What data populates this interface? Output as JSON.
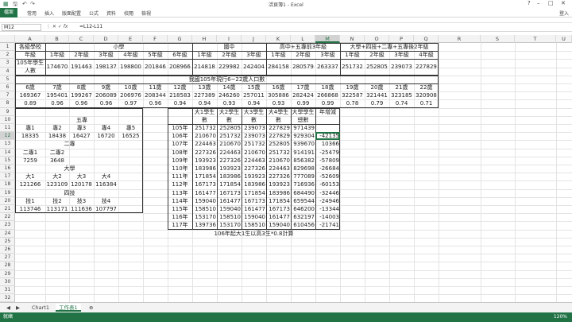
{
  "window": {
    "title": "活頁簿1 - Excel",
    "user": "登入"
  },
  "ribbon": {
    "file": "檔案",
    "tabs": [
      "常用",
      "插入",
      "版面配置",
      "公式",
      "資料",
      "校閱",
      "檢視"
    ]
  },
  "formula_bar": {
    "name_box": "M12",
    "formula": "=L12-L11"
  },
  "columns": [
    "A",
    "B",
    "C",
    "D",
    "E",
    "F",
    "G",
    "H",
    "I",
    "J",
    "K",
    "L",
    "M",
    "N",
    "O",
    "P",
    "Q",
    "R",
    "S",
    "T",
    "U"
  ],
  "rows": [
    "1",
    "2",
    "3",
    "4",
    "5",
    "6",
    "7",
    "8",
    "9",
    "10",
    "11",
    "12",
    "13",
    "14",
    "15",
    "16",
    "17",
    "18",
    "19",
    "20",
    "21",
    "22",
    "23",
    "24",
    "25",
    "26",
    "27",
    "28",
    "29",
    "30",
    "31",
    "32"
  ],
  "table1": {
    "header": [
      "各級學校",
      "小學",
      "國中",
      "高中+五專前3年級",
      "大學+四技+二專+五專後2年級"
    ],
    "grades": [
      "年級",
      "1年級",
      "2年級",
      "3年級",
      "4年級",
      "5年級",
      "6年級",
      "1年級",
      "2年級",
      "3年級",
      "1年級",
      "2年級",
      "3年級",
      "1年級",
      "2年級",
      "3年級",
      "4年級"
    ],
    "label": "105年學生人數",
    "values": [
      "174670",
      "191463",
      "198137",
      "198800",
      "201846",
      "208966",
      "214818",
      "229982",
      "242404",
      "284158",
      "280579",
      "263337",
      "251732",
      "252805",
      "239073",
      "227829"
    ]
  },
  "table2": {
    "title": "我國105年現行6~22歲人口數",
    "ages": [
      "6歲",
      "7歲",
      "8歲",
      "9歲",
      "10歲",
      "11歲",
      "12歲",
      "13歲",
      "14歲",
      "15歲",
      "16歲",
      "17歲",
      "18歲",
      "19歲",
      "20歲",
      "21歲",
      "22歲"
    ],
    "pop": [
      "169367",
      "195401",
      "199267",
      "206089",
      "206976",
      "208344",
      "218583",
      "227389",
      "246260",
      "257011",
      "305886",
      "282424",
      "266868",
      "322587",
      "321441",
      "323185",
      "320908"
    ],
    "rate_label": "就學率",
    "rates": [
      "0.89",
      "0.96",
      "0.96",
      "0.96",
      "0.97",
      "0.96",
      "0.94",
      "0.94",
      "0.93",
      "0.94",
      "0.93",
      "0.99",
      "0.99",
      "0.78",
      "0.79",
      "0.74",
      "0.71"
    ]
  },
  "table3": {
    "title": "五專",
    "h1": [
      "專1",
      "專2",
      "專3",
      "專4",
      "專5"
    ],
    "v1": [
      "18335",
      "18438",
      "16427",
      "16720",
      "16525"
    ],
    "t2": "二專",
    "h2": [
      "二專1",
      "二專2"
    ],
    "v2": [
      "7259",
      "3648"
    ],
    "t3": "大學",
    "h3": [
      "大1",
      "大2",
      "大3",
      "大4"
    ],
    "v3": [
      "121266",
      "123109",
      "120178",
      "116384"
    ],
    "t4": "四技",
    "h4": [
      "技1",
      "技2",
      "技3",
      "技4"
    ],
    "v4": [
      "113746",
      "113171",
      "111636",
      "107797"
    ]
  },
  "table4": {
    "headers": [
      "大1學生數",
      "大2學生數",
      "大3學生數",
      "大4學生數",
      "大學學生總數",
      "年增減"
    ],
    "rows": [
      [
        "105年",
        "251732",
        "252805",
        "239073",
        "227829",
        "971439",
        ""
      ],
      [
        "106年",
        "210670",
        "251732",
        "239073",
        "227829",
        "929304",
        "-42135"
      ],
      [
        "107年",
        "224463",
        "210670",
        "251732",
        "252805",
        "939670",
        "10366"
      ],
      [
        "108年",
        "227326",
        "224463",
        "210670",
        "251732",
        "914191",
        "-25479"
      ],
      [
        "109年",
        "193923",
        "227326",
        "224463",
        "210670",
        "856382",
        "-57809"
      ],
      [
        "110年",
        "183986",
        "193923",
        "227326",
        "224463",
        "829698",
        "-26684"
      ],
      [
        "111年",
        "171854",
        "183986",
        "193923",
        "227326",
        "777089",
        "-52609"
      ],
      [
        "112年",
        "167173",
        "171854",
        "183986",
        "193923",
        "716936",
        "-60153"
      ],
      [
        "113年",
        "161477",
        "167173",
        "171854",
        "183986",
        "684490",
        "-32446"
      ],
      [
        "114年",
        "159040",
        "161477",
        "167173",
        "171854",
        "659544",
        "-24946"
      ],
      [
        "115年",
        "158510",
        "159040",
        "161477",
        "167173",
        "646200",
        "-13344"
      ],
      [
        "116年",
        "153170",
        "158510",
        "159040",
        "161477",
        "632197",
        "-14003"
      ],
      [
        "117年",
        "139736",
        "153170",
        "158510",
        "159040",
        "610456",
        "-21741"
      ]
    ],
    "note": "106年起大1生以高3生*0.8計算"
  },
  "sheets": [
    "Chart1",
    "工作表1"
  ],
  "status": {
    "ready": "就緒",
    "zoom": "120%"
  }
}
